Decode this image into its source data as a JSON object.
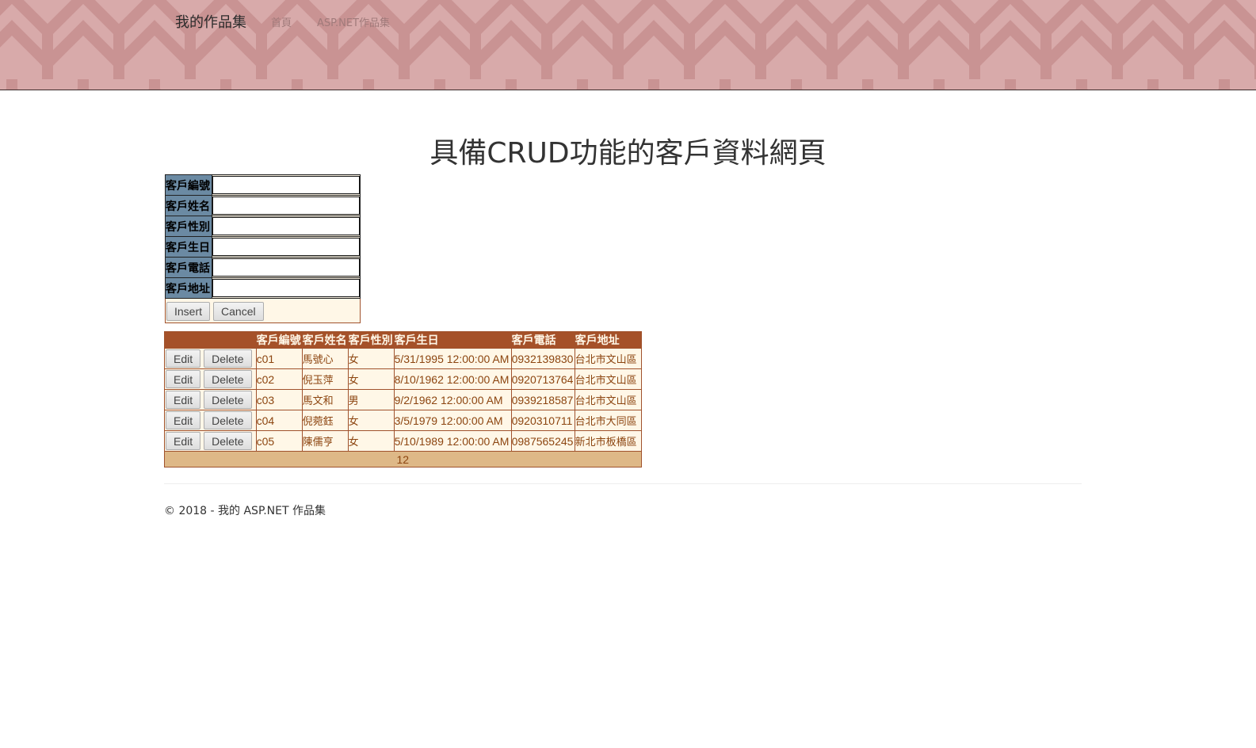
{
  "navbar": {
    "brand": "我的作品集",
    "links": [
      "首頁",
      "ASP.NET作品集"
    ]
  },
  "page_title": "具備CRUD功能的客戶資料網頁",
  "form": {
    "fields": [
      {
        "label": "客戶編號",
        "value": ""
      },
      {
        "label": "客戶姓名",
        "value": ""
      },
      {
        "label": "客戶性別",
        "value": ""
      },
      {
        "label": "客戶生日",
        "value": ""
      },
      {
        "label": "客戶電話",
        "value": ""
      },
      {
        "label": "客戶地址",
        "value": ""
      }
    ],
    "insert_label": "Insert",
    "cancel_label": "Cancel"
  },
  "grid": {
    "headers": [
      "",
      "客戶編號",
      "客戶姓名",
      "客戶性別",
      "客戶生日",
      "客戶電話",
      "客戶地址"
    ],
    "edit_label": "Edit",
    "delete_label": "Delete",
    "rows": [
      {
        "id": "c01",
        "name": "馬號心",
        "gender": "女",
        "birthday": "5/31/1995 12:00:00 AM",
        "phone": "0932139830",
        "address": "台北市文山區"
      },
      {
        "id": "c02",
        "name": "倪玉萍",
        "gender": "女",
        "birthday": "8/10/1962 12:00:00 AM",
        "phone": "0920713764",
        "address": "台北市文山區"
      },
      {
        "id": "c03",
        "name": "馬文和",
        "gender": "男",
        "birthday": "9/2/1962 12:00:00 AM",
        "phone": "0939218587",
        "address": "台北市文山區"
      },
      {
        "id": "c04",
        "name": "倪菀鈺",
        "gender": "女",
        "birthday": "3/5/1979 12:00:00 AM",
        "phone": "0920310711",
        "address": "台北市大同區"
      },
      {
        "id": "c05",
        "name": "陳儒亨",
        "gender": "女",
        "birthday": "5/10/1989 12:00:00 AM",
        "phone": "0987565245",
        "address": "新北市板橋區"
      }
    ],
    "pager": [
      "1",
      "2"
    ]
  },
  "footer": "© 2018 - 我的 ASP.NET 作品集",
  "colors": {
    "navbar_bg": "#d7a9a9",
    "grid_header": "#a55129",
    "grid_row": "#fff7e7",
    "grid_text": "#8c4510",
    "pager_bg": "#deb887",
    "form_label_bg": "#6b8aa3"
  }
}
